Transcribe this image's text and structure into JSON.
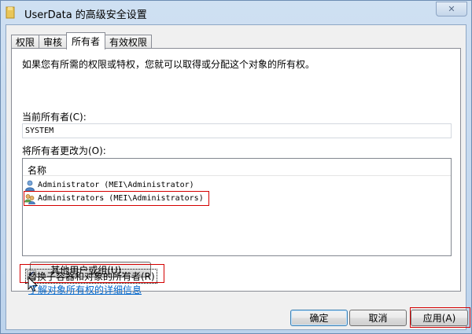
{
  "window": {
    "title": "UserData 的高级安全设置",
    "close_glyph": "✕"
  },
  "tabs": [
    {
      "label": "权限",
      "active": false
    },
    {
      "label": "审核",
      "active": false
    },
    {
      "label": "所有者",
      "active": true
    },
    {
      "label": "有效权限",
      "active": false
    }
  ],
  "owner": {
    "intro": "如果您有所需的权限或特权，您就可以取得或分配这个对象的所有权。",
    "current_label": "当前所有者(C):",
    "current_value": "SYSTEM",
    "change_label": "将所有者更改为(O):",
    "list_header": "名称",
    "list_items": [
      {
        "label": "Administrator (MEI\\Administrator)",
        "icon": "user-icon"
      },
      {
        "label": "Administrators (MEI\\Administrators)",
        "icon": "group-icon"
      }
    ],
    "other_button": "其他用户或组(U)...",
    "replace_checkbox_label": "替换子容器和对象的所有者(R)",
    "replace_checked": true,
    "check_glyph": "✔",
    "learn_link": "了解对象所有权的详细信息"
  },
  "buttons": {
    "ok": "确定",
    "cancel": "取消",
    "apply": "应用(A)"
  },
  "colors": {
    "highlight": "#d40000",
    "link": "#0066cc",
    "frame": "#bcd3ec"
  }
}
